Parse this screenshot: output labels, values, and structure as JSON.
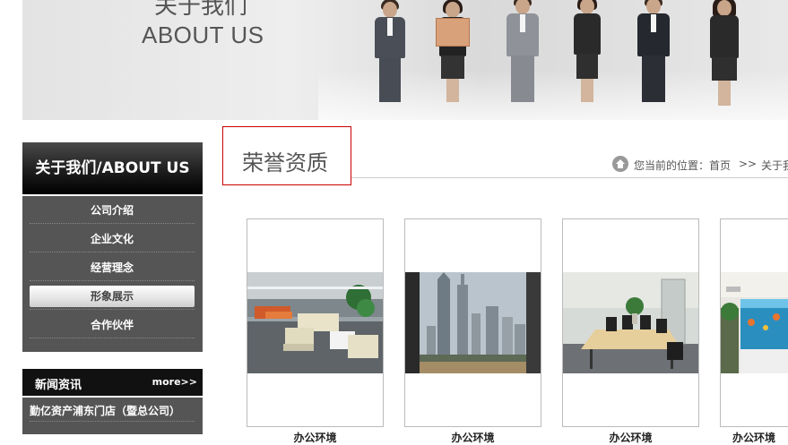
{
  "banner": {
    "title_zh": "关于我们",
    "title_en": "ABOUT US"
  },
  "sidebar": {
    "header": "关于我们/ABOUT US",
    "items": [
      {
        "label": "公司介绍",
        "active": false
      },
      {
        "label": "企业文化",
        "active": false
      },
      {
        "label": "经营理念",
        "active": false
      },
      {
        "label": "形象展示",
        "active": true
      },
      {
        "label": "合作伙伴",
        "active": false
      }
    ]
  },
  "news": {
    "title": "新闻资讯",
    "more": "more>>",
    "items": [
      "勤亿资产浦东门店（暨总公司）"
    ]
  },
  "main": {
    "title": "荣誉资质",
    "breadcrumb": {
      "label": "您当前的位置：",
      "home": "首页",
      "separator": ">>",
      "current": "关于我"
    },
    "cards": [
      {
        "caption": "办公环境",
        "photo": "office-lounge"
      },
      {
        "caption": "办公环境",
        "photo": "city-skyline"
      },
      {
        "caption": "办公环境",
        "photo": "meeting-room"
      },
      {
        "caption": "办公环境",
        "photo": "aquarium-lobby"
      }
    ]
  },
  "colors": {
    "accent_border": "#cc0000",
    "sidebar_bg": "#555555",
    "header_bg": "#111111"
  }
}
